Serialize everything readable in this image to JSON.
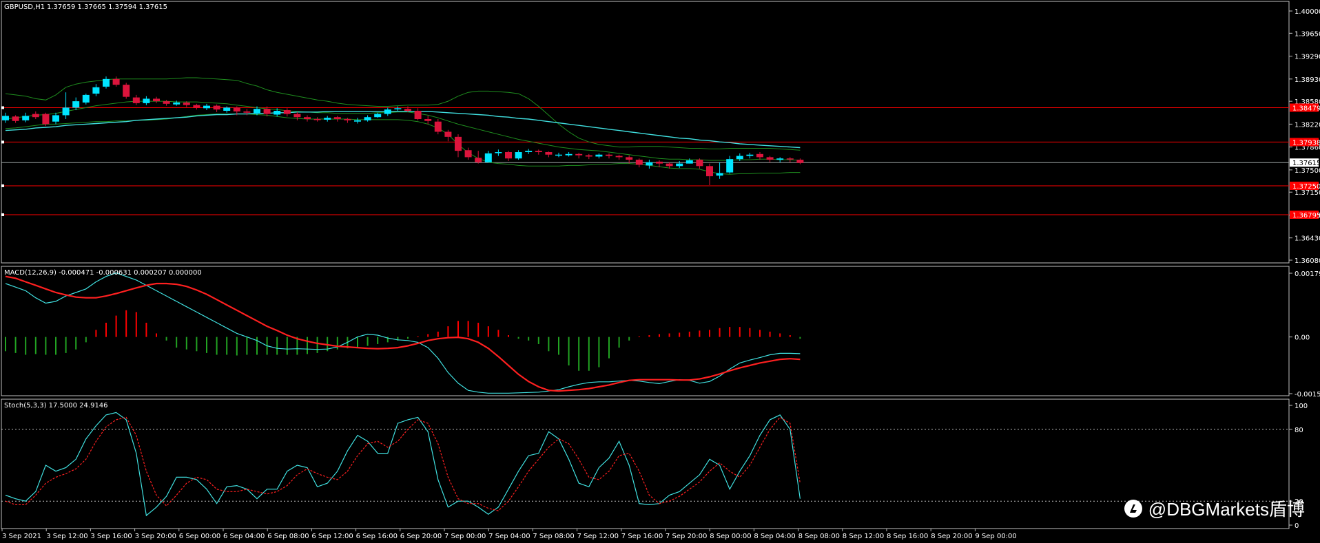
{
  "header": {
    "symbol": "GBPUSD,H1",
    "ohlc": "1.37659 1.37665 1.37594 1.37615"
  },
  "macd_label": "MACD(12,26,9) -0.000471 -0.000631 0.000207 0.000000",
  "stoch_label": "Stoch(5,3,3) 17.5000 24.9146",
  "watermark": "@DBGMarkets盾博",
  "colors": {
    "background": "#000000",
    "bull_candle": "#00e5ff",
    "bear_candle": "#dc143c",
    "bollinger_band": "#1f8f1f",
    "moving_average": "#40e0e0",
    "horizontal_level": "#ff0000",
    "macd_hist_pos": "#ff0000",
    "macd_hist_neg": "#22a322",
    "macd_signal": "#ff2020",
    "stoch_main": "#40e0e0",
    "stoch_signal": "#ff2020"
  },
  "chart_data": [
    {
      "type": "candlestick",
      "title": "GBPUSD,H1",
      "y_ticks": [
        "1.40000",
        "1.39650",
        "1.39290",
        "1.38930",
        "1.38580",
        "1.38220",
        "1.37860",
        "1.37500",
        "1.37150",
        "1.36790",
        "1.36430",
        "1.36080"
      ],
      "y_range": [
        1.3608,
        1.4
      ],
      "current_price": "1.37615",
      "horizontal_levels": [
        {
          "value": 1.38479,
          "label": "1.38479"
        },
        {
          "value": 1.37938,
          "label": "1.37938"
        },
        {
          "value": 1.3725,
          "label": "1.37250"
        },
        {
          "value": 1.36795,
          "label": "1.36795"
        }
      ],
      "x_ticks": [
        "3 Sep 2021",
        "3 Sep 12:00",
        "3 Sep 16:00",
        "3 Sep 20:00",
        "6 Sep 00:00",
        "6 Sep 04:00",
        "6 Sep 08:00",
        "6 Sep 12:00",
        "6 Sep 16:00",
        "6 Sep 20:00",
        "7 Sep 00:00",
        "7 Sep 04:00",
        "7 Sep 08:00",
        "7 Sep 12:00",
        "7 Sep 16:00",
        "7 Sep 20:00",
        "8 Sep 00:00",
        "8 Sep 04:00",
        "8 Sep 08:00",
        "8 Sep 12:00",
        "8 Sep 16:00",
        "8 Sep 20:00",
        "9 Sep 00:00"
      ],
      "close": [
        1.3835,
        1.3827,
        1.3835,
        1.3833,
        1.3822,
        1.3836,
        1.3848,
        1.3858,
        1.3868,
        1.388,
        1.3893,
        1.3884,
        1.3865,
        1.3855,
        1.3862,
        1.3858,
        1.3854,
        1.3856,
        1.3852,
        1.3848,
        1.3851,
        1.3845,
        1.3848,
        1.3842,
        1.384,
        1.3846,
        1.3838,
        1.3843,
        1.3838,
        1.3833,
        1.383,
        1.3829,
        1.3832,
        1.383,
        1.3828,
        1.3828,
        1.3833,
        1.3838,
        1.3845,
        1.3847,
        1.3843,
        1.383,
        1.3827,
        1.381,
        1.3802,
        1.378,
        1.377,
        1.3762,
        1.3776,
        1.3778,
        1.3768,
        1.3778,
        1.378,
        1.3778,
        1.3774,
        1.3774,
        1.3775,
        1.3773,
        1.3771,
        1.3774,
        1.3772,
        1.377,
        1.3766,
        1.3758,
        1.3762,
        1.376,
        1.3756,
        1.376,
        1.3765,
        1.3756,
        1.374,
        1.3745,
        1.3767,
        1.3772,
        1.3774,
        1.377,
        1.3766,
        1.3768,
        1.3767,
        1.3761
      ],
      "open": [
        1.3828,
        1.3834,
        1.3828,
        1.3838,
        1.3838,
        1.3826,
        1.3836,
        1.3848,
        1.3856,
        1.387,
        1.3881,
        1.3893,
        1.3884,
        1.3864,
        1.3855,
        1.3862,
        1.3858,
        1.3853,
        1.3856,
        1.3852,
        1.3847,
        1.3851,
        1.3843,
        1.3848,
        1.3842,
        1.3839,
        1.3846,
        1.3837,
        1.3844,
        1.3838,
        1.3833,
        1.383,
        1.3829,
        1.3833,
        1.383,
        1.3826,
        1.3828,
        1.3833,
        1.3838,
        1.3846,
        1.3846,
        1.3843,
        1.383,
        1.3826,
        1.381,
        1.3802,
        1.3781,
        1.3769,
        1.3762,
        1.3777,
        1.3778,
        1.3768,
        1.3778,
        1.378,
        1.3778,
        1.3774,
        1.3773,
        1.3775,
        1.3773,
        1.3771,
        1.3774,
        1.3772,
        1.377,
        1.3766,
        1.3757,
        1.3763,
        1.376,
        1.3756,
        1.376,
        1.3766,
        1.3756,
        1.3741,
        1.3746,
        1.3767,
        1.3772,
        1.3775,
        1.377,
        1.3766,
        1.3768,
        1.3766
      ],
      "high": [
        1.384,
        1.3836,
        1.384,
        1.3842,
        1.384,
        1.384,
        1.3872,
        1.3864,
        1.387,
        1.3885,
        1.3897,
        1.3897,
        1.3887,
        1.3868,
        1.3866,
        1.3865,
        1.386,
        1.3859,
        1.3858,
        1.3854,
        1.3854,
        1.3853,
        1.385,
        1.385,
        1.3846,
        1.385,
        1.385,
        1.3847,
        1.3847,
        1.3841,
        1.3836,
        1.3833,
        1.3835,
        1.3835,
        1.3832,
        1.3832,
        1.3836,
        1.384,
        1.3848,
        1.385,
        1.385,
        1.3847,
        1.3835,
        1.383,
        1.3813,
        1.3806,
        1.3785,
        1.378,
        1.378,
        1.3782,
        1.378,
        1.3781,
        1.3783,
        1.3782,
        1.3779,
        1.3777,
        1.3778,
        1.3777,
        1.3775,
        1.3776,
        1.3776,
        1.3774,
        1.3773,
        1.3768,
        1.3766,
        1.3765,
        1.3762,
        1.3764,
        1.3768,
        1.3768,
        1.376,
        1.3762,
        1.3772,
        1.3776,
        1.3777,
        1.3778,
        1.3772,
        1.377,
        1.377,
        1.3768
      ],
      "low": [
        1.3824,
        1.3824,
        1.3825,
        1.383,
        1.3819,
        1.3822,
        1.383,
        1.3844,
        1.3853,
        1.3866,
        1.3878,
        1.3881,
        1.3862,
        1.3852,
        1.3852,
        1.3855,
        1.3851,
        1.3851,
        1.3849,
        1.3845,
        1.3844,
        1.3841,
        1.384,
        1.3836,
        1.3836,
        1.3836,
        1.3834,
        1.3834,
        1.3834,
        1.3828,
        1.3826,
        1.3826,
        1.3826,
        1.3826,
        1.3824,
        1.3823,
        1.3826,
        1.3832,
        1.3835,
        1.3843,
        1.3841,
        1.3828,
        1.3822,
        1.3806,
        1.3795,
        1.377,
        1.3766,
        1.376,
        1.3766,
        1.3772,
        1.3764,
        1.3766,
        1.3775,
        1.3774,
        1.377,
        1.377,
        1.3771,
        1.3768,
        1.3767,
        1.3768,
        1.3768,
        1.3766,
        1.376,
        1.3754,
        1.3752,
        1.3754,
        1.3752,
        1.3753,
        1.376,
        1.3752,
        1.3726,
        1.3736,
        1.3744,
        1.3764,
        1.3768,
        1.3766,
        1.3762,
        1.3762,
        1.3762,
        1.3759
      ],
      "bb_upper": [
        1.387,
        1.3868,
        1.3866,
        1.3862,
        1.386,
        1.3868,
        1.388,
        1.3885,
        1.3888,
        1.389,
        1.3892,
        1.3893,
        1.3893,
        1.3893,
        1.3893,
        1.3893,
        1.3893,
        1.3894,
        1.3895,
        1.3895,
        1.3894,
        1.3893,
        1.3892,
        1.3891,
        1.3886,
        1.3882,
        1.3876,
        1.3872,
        1.3869,
        1.3866,
        1.3863,
        1.386,
        1.3858,
        1.3855,
        1.3853,
        1.3852,
        1.3851,
        1.385,
        1.385,
        1.3851,
        1.3852,
        1.3852,
        1.3852,
        1.3853,
        1.3858,
        1.3866,
        1.3872,
        1.3874,
        1.3874,
        1.3873,
        1.3872,
        1.387,
        1.3862,
        1.385,
        1.3836,
        1.3822,
        1.381,
        1.38,
        1.3794,
        1.379,
        1.3788,
        1.3786,
        1.3786,
        1.3787,
        1.3787,
        1.3787,
        1.3786,
        1.3785,
        1.3784,
        1.3784,
        1.3783,
        1.3783,
        1.3784,
        1.3784,
        1.3784,
        1.3784,
        1.3784,
        1.3783,
        1.3782,
        1.3781
      ],
      "bb_lower": [
        1.3815,
        1.3816,
        1.3818,
        1.382,
        1.3822,
        1.3822,
        1.3823,
        1.3824,
        1.3825,
        1.3826,
        1.3826,
        1.3827,
        1.3827,
        1.3828,
        1.3828,
        1.3829,
        1.383,
        1.3832,
        1.3834,
        1.3836,
        1.3837,
        1.3838,
        1.3838,
        1.3838,
        1.3838,
        1.3837,
        1.3836,
        1.3834,
        1.3832,
        1.3831,
        1.383,
        1.383,
        1.383,
        1.383,
        1.383,
        1.3829,
        1.3829,
        1.3829,
        1.3829,
        1.3829,
        1.3828,
        1.3826,
        1.3822,
        1.3816,
        1.3806,
        1.379,
        1.3777,
        1.3768,
        1.3762,
        1.376,
        1.3759,
        1.3757,
        1.3756,
        1.3756,
        1.3756,
        1.3756,
        1.3757,
        1.3757,
        1.3758,
        1.3759,
        1.3759,
        1.376,
        1.376,
        1.3759,
        1.3757,
        1.3755,
        1.3753,
        1.3752,
        1.3752,
        1.3751,
        1.3747,
        1.3744,
        1.3743,
        1.3744,
        1.3744,
        1.3745,
        1.3745,
        1.3745,
        1.3746,
        1.3746
      ],
      "bb_mid": [
        1.383,
        1.3832,
        1.3834,
        1.3836,
        1.3837,
        1.3839,
        1.3842,
        1.3845,
        1.3848,
        1.3851,
        1.3853,
        1.3855,
        1.3857,
        1.3858,
        1.3858,
        1.3858,
        1.3858,
        1.3857,
        1.3857,
        1.3857,
        1.3856,
        1.3855,
        1.3854,
        1.3852,
        1.385,
        1.3848,
        1.3846,
        1.3845,
        1.3843,
        1.3842,
        1.3841,
        1.384,
        1.384,
        1.3839,
        1.3839,
        1.3839,
        1.3839,
        1.384,
        1.384,
        1.3841,
        1.3841,
        1.3839,
        1.3836,
        1.3832,
        1.3827,
        1.3822,
        1.3818,
        1.3814,
        1.381,
        1.3806,
        1.3802,
        1.3798,
        1.3795,
        1.3792,
        1.3789,
        1.3786,
        1.3784,
        1.3782,
        1.3781,
        1.378,
        1.3778,
        1.3776,
        1.3774,
        1.3772,
        1.377,
        1.3768,
        1.3767,
        1.3767,
        1.3766,
        1.3766,
        1.3765,
        1.3765,
        1.3765,
        1.3766,
        1.3766,
        1.3767,
        1.3767,
        1.3766,
        1.3766,
        1.3765
      ],
      "ma_slow": [
        1.3812,
        1.3813,
        1.3814,
        1.3816,
        1.3817,
        1.3818,
        1.382,
        1.3821,
        1.3822,
        1.3823,
        1.3824,
        1.3825,
        1.3826,
        1.3828,
        1.3829,
        1.383,
        1.3831,
        1.3832,
        1.3833,
        1.3835,
        1.3836,
        1.3837,
        1.3837,
        1.3838,
        1.3838,
        1.3839,
        1.3839,
        1.384,
        1.384,
        1.3841,
        1.3841,
        1.3841,
        1.3842,
        1.3842,
        1.3842,
        1.3842,
        1.3842,
        1.3842,
        1.3842,
        1.3842,
        1.3842,
        1.3842,
        1.3842,
        1.3841,
        1.384,
        1.3839,
        1.3838,
        1.3837,
        1.3836,
        1.3834,
        1.3833,
        1.3831,
        1.383,
        1.3828,
        1.3826,
        1.3824,
        1.3822,
        1.382,
        1.3818,
        1.3816,
        1.3814,
        1.3812,
        1.381,
        1.3808,
        1.3806,
        1.3804,
        1.3802,
        1.38,
        1.3799,
        1.3797,
        1.3796,
        1.3794,
        1.3793,
        1.3791,
        1.379,
        1.3789,
        1.3788,
        1.3787,
        1.3786,
        1.3785
      ]
    },
    {
      "type": "macd",
      "label": "MACD(12,26,9) -0.000471 -0.000631 0.000207 0.000000",
      "y_ticks": [
        "0.001791",
        "0.00",
        "-0.001593"
      ],
      "y_range": [
        -0.001593,
        0.001791
      ],
      "histogram": [
        -0.0004,
        -0.00045,
        -0.0005,
        -0.00048,
        -0.0005,
        -0.0005,
        -0.00045,
        -0.00035,
        -0.00015,
        0.0002,
        0.0004,
        0.0006,
        0.00075,
        0.0007,
        0.0004,
        0.0001,
        -0.0001,
        -0.0003,
        -0.00035,
        -0.0004,
        -0.00045,
        -0.0005,
        -0.0005,
        -0.00052,
        -0.0005,
        -0.0005,
        -0.0005,
        -0.0005,
        -0.0005,
        -0.0005,
        -0.00048,
        -0.00045,
        -0.0004,
        -0.00035,
        -0.00032,
        -0.0003,
        -0.00025,
        -0.0002,
        -0.00015,
        -0.0001,
        -5e-05,
        2e-05,
        8e-05,
        0.00015,
        0.0003,
        0.00045,
        0.00045,
        0.0004,
        0.0003,
        0.0002,
        5e-05,
        -5e-05,
        -0.0001,
        -0.0002,
        -0.0004,
        -0.0005,
        -0.0008,
        -0.00095,
        -0.00095,
        -0.00085,
        -0.0006,
        -0.0003,
        -0.0001,
        2e-05,
        5e-05,
        8e-05,
        0.0001,
        0.00012,
        0.00015,
        0.00018,
        0.0002,
        0.00025,
        0.00028,
        0.00028,
        0.00025,
        0.0002,
        0.00015,
        0.0001,
        5e-05,
        -5e-05
      ],
      "signal": [
        0.0017,
        0.00165,
        0.00155,
        0.00145,
        0.00135,
        0.00125,
        0.00118,
        0.00112,
        0.0011,
        0.0011,
        0.00115,
        0.00122,
        0.0013,
        0.00138,
        0.00145,
        0.0015,
        0.0015,
        0.00148,
        0.00142,
        0.00132,
        0.0012,
        0.00105,
        0.0009,
        0.00075,
        0.0006,
        0.00045,
        0.0003,
        0.00018,
        5e-05,
        -5e-05,
        -0.00012,
        -0.00018,
        -0.00022,
        -0.00026,
        -0.00028,
        -0.0003,
        -0.00032,
        -0.00033,
        -0.00032,
        -0.0003,
        -0.00025,
        -0.00018,
        -0.0001,
        -5e-05,
        -2e-05,
        -1e-05,
        -5e-05,
        -0.00015,
        -0.00032,
        -0.00055,
        -0.0008,
        -0.00105,
        -0.00125,
        -0.0014,
        -0.0015,
        -0.00152,
        -0.0015,
        -0.00148,
        -0.00145,
        -0.0014,
        -0.00135,
        -0.00128,
        -0.00122,
        -0.0012,
        -0.0012,
        -0.0012,
        -0.0012,
        -0.00121,
        -0.00121,
        -0.00118,
        -0.00112,
        -0.00104,
        -0.00095,
        -0.00087,
        -0.0008,
        -0.00073,
        -0.00068,
        -0.00063,
        -0.00061,
        -0.00063
      ],
      "macd": [
        0.0015,
        0.0014,
        0.0013,
        0.0011,
        0.00095,
        0.001,
        0.00115,
        0.00125,
        0.00135,
        0.00155,
        0.0017,
        0.0018,
        0.0017,
        0.0016,
        0.00145,
        0.0013,
        0.00115,
        0.001,
        0.00085,
        0.0007,
        0.00055,
        0.0004,
        0.00025,
        0.0001,
        0.0,
        -0.0001,
        -0.00025,
        -0.00032,
        -0.00034,
        -0.00033,
        -0.00034,
        -0.00035,
        -0.00034,
        -0.00028,
        -0.00015,
        0.0,
        8e-05,
        5e-05,
        -3e-05,
        -8e-05,
        -0.0001,
        -0.00015,
        -0.0003,
        -0.0006,
        -0.001,
        -0.0013,
        -0.0015,
        -0.00155,
        -0.00158,
        -0.00158,
        -0.00158,
        -0.00157,
        -0.00156,
        -0.00155,
        -0.00152,
        -0.00148,
        -0.0014,
        -0.00133,
        -0.00128,
        -0.00126,
        -0.00126,
        -0.00124,
        -0.00122,
        -0.00124,
        -0.00128,
        -0.00131,
        -0.00125,
        -0.0012,
        -0.00122,
        -0.0013,
        -0.00125,
        -0.0011,
        -0.0009,
        -0.00073,
        -0.00065,
        -0.00058,
        -0.0005,
        -0.00046,
        -0.00046,
        -0.00047
      ]
    },
    {
      "type": "stochastic",
      "label": "Stoch(5,3,3) 17.5000 24.9146",
      "y_ticks": [
        "100",
        "80",
        "20",
        "0"
      ],
      "y_range": [
        0,
        100
      ],
      "levels": [
        80,
        20
      ],
      "main": [
        25,
        22,
        20,
        28,
        50,
        45,
        48,
        55,
        72,
        83,
        92,
        94,
        88,
        60,
        8,
        15,
        24,
        40,
        40,
        38,
        30,
        18,
        32,
        33,
        30,
        22,
        30,
        30,
        45,
        50,
        48,
        32,
        35,
        45,
        62,
        75,
        70,
        60,
        60,
        85,
        88,
        90,
        78,
        38,
        15,
        20,
        20,
        15,
        9,
        15,
        30,
        45,
        58,
        60,
        78,
        72,
        55,
        35,
        32,
        48,
        56,
        70,
        50,
        18,
        17,
        18,
        25,
        28,
        35,
        42,
        55,
        50,
        30,
        45,
        58,
        75,
        88,
        92,
        80,
        22
      ],
      "signal": [
        20,
        17,
        17,
        25,
        35,
        40,
        43,
        47,
        55,
        70,
        82,
        88,
        90,
        75,
        45,
        25,
        16,
        25,
        35,
        40,
        38,
        30,
        28,
        28,
        30,
        28,
        26,
        28,
        33,
        42,
        47,
        43,
        40,
        38,
        45,
        58,
        68,
        70,
        65,
        70,
        80,
        88,
        85,
        68,
        40,
        22,
        18,
        18,
        14,
        12,
        20,
        32,
        45,
        55,
        65,
        72,
        68,
        55,
        40,
        38,
        45,
        58,
        60,
        45,
        25,
        18,
        20,
        24,
        30,
        36,
        45,
        52,
        45,
        40,
        50,
        65,
        80,
        90,
        85,
        35
      ]
    }
  ]
}
